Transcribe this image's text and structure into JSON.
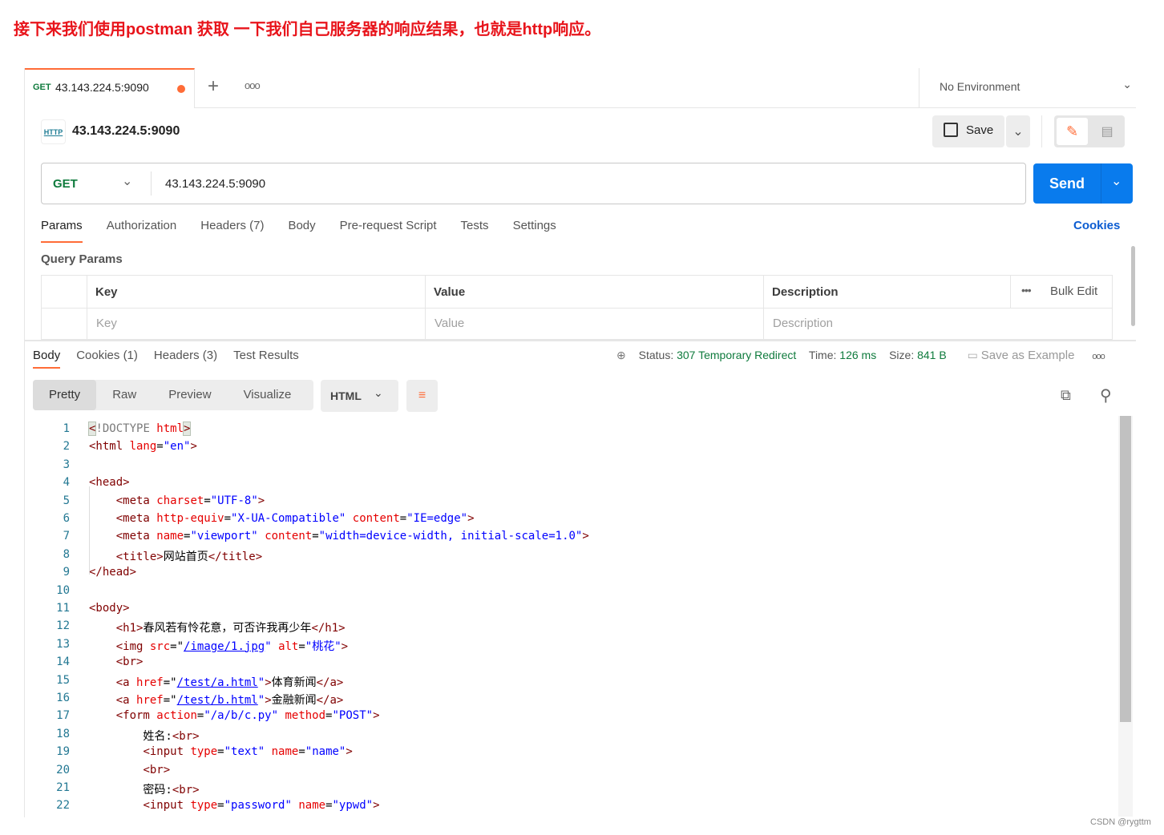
{
  "banner": "接下来我们使用postman 获取 一下我们自己服务器的响应结果，也就是http响应。",
  "tab": {
    "method": "GET",
    "title": "43.143.224.5:9090",
    "unsaved_color": "#ff6c37"
  },
  "environment": "No Environment",
  "request": {
    "name": "43.143.224.5:9090",
    "method": "GET",
    "url": "43.143.224.5:9090",
    "save": "Save",
    "send": "Send"
  },
  "req_tabs": [
    {
      "label": "Params",
      "active": true
    },
    {
      "label": "Authorization"
    },
    {
      "label": "Headers (7)"
    },
    {
      "label": "Body"
    },
    {
      "label": "Pre-request Script"
    },
    {
      "label": "Tests"
    },
    {
      "label": "Settings"
    }
  ],
  "cookies_link": "Cookies",
  "query_params": {
    "title": "Query Params",
    "headers": [
      "Key",
      "Value",
      "Description"
    ],
    "bulk_edit": "Bulk Edit",
    "placeholders": [
      "Key",
      "Value",
      "Description"
    ]
  },
  "resp_tabs": [
    {
      "label": "Body",
      "active": true
    },
    {
      "label": "Cookies (1)"
    },
    {
      "label": "Headers (3)"
    },
    {
      "label": "Test Results"
    }
  ],
  "status": {
    "status_label": "Status:",
    "status": "307 Temporary Redirect",
    "time_label": "Time:",
    "time": "126 ms",
    "size_label": "Size:",
    "size": "841 B",
    "save_example": "Save as Example"
  },
  "view_modes": [
    "Pretty",
    "Raw",
    "Preview",
    "Visualize"
  ],
  "format": "HTML",
  "colors": {
    "accent": "#ff6c37",
    "send": "#097bed",
    "ok": "#0f7b3d",
    "link": "#0b5cd1"
  },
  "code": [
    [
      [
        "b",
        "<"
      ],
      [
        "d",
        "!DOCTYPE "
      ],
      [
        "a",
        "html"
      ],
      [
        "b",
        ">"
      ]
    ],
    [
      [
        "t",
        "<html "
      ],
      [
        "a",
        "lang"
      ],
      [
        "x",
        "="
      ],
      [
        "v",
        "\"en\""
      ],
      [
        "t",
        ">"
      ]
    ],
    [],
    [
      [
        "t",
        "<head>"
      ]
    ],
    [
      [
        "x",
        "    "
      ],
      [
        "t",
        "<meta "
      ],
      [
        "a",
        "charset"
      ],
      [
        "x",
        "="
      ],
      [
        "v",
        "\"UTF-8\""
      ],
      [
        "t",
        ">"
      ]
    ],
    [
      [
        "x",
        "    "
      ],
      [
        "t",
        "<meta "
      ],
      [
        "a",
        "http-equiv"
      ],
      [
        "x",
        "="
      ],
      [
        "v",
        "\"X-UA-Compatible\""
      ],
      [
        "x",
        " "
      ],
      [
        "a",
        "content"
      ],
      [
        "x",
        "="
      ],
      [
        "v",
        "\"IE=edge\""
      ],
      [
        "t",
        ">"
      ]
    ],
    [
      [
        "x",
        "    "
      ],
      [
        "t",
        "<meta "
      ],
      [
        "a",
        "name"
      ],
      [
        "x",
        "="
      ],
      [
        "v",
        "\"viewport\""
      ],
      [
        "x",
        " "
      ],
      [
        "a",
        "content"
      ],
      [
        "x",
        "="
      ],
      [
        "v",
        "\"width=device-width, initial-scale=1.0\""
      ],
      [
        "t",
        ">"
      ]
    ],
    [
      [
        "x",
        "    "
      ],
      [
        "t",
        "<title>"
      ],
      [
        "x",
        "网站首页"
      ],
      [
        "t",
        "</title>"
      ]
    ],
    [
      [
        "t",
        "</head>"
      ]
    ],
    [],
    [
      [
        "t",
        "<body>"
      ]
    ],
    [
      [
        "x",
        "    "
      ],
      [
        "t",
        "<h1>"
      ],
      [
        "x",
        "春风若有怜花意，可否许我再少年"
      ],
      [
        "t",
        "</h1>"
      ]
    ],
    [
      [
        "x",
        "    "
      ],
      [
        "t",
        "<img "
      ],
      [
        "a",
        "src"
      ],
      [
        "x",
        "=\""
      ],
      [
        "l",
        "/image/1.jpg"
      ],
      [
        "v",
        "\""
      ],
      [
        "x",
        " "
      ],
      [
        "a",
        "alt"
      ],
      [
        "x",
        "="
      ],
      [
        "v",
        "\"桃花\""
      ],
      [
        "t",
        ">"
      ]
    ],
    [
      [
        "x",
        "    "
      ],
      [
        "t",
        "<br>"
      ]
    ],
    [
      [
        "x",
        "    "
      ],
      [
        "t",
        "<a "
      ],
      [
        "a",
        "href"
      ],
      [
        "x",
        "=\""
      ],
      [
        "l",
        "/test/a.html"
      ],
      [
        "v",
        "\""
      ],
      [
        "t",
        ">"
      ],
      [
        "x",
        "体育新闻"
      ],
      [
        "t",
        "</a>"
      ]
    ],
    [
      [
        "x",
        "    "
      ],
      [
        "t",
        "<a "
      ],
      [
        "a",
        "href"
      ],
      [
        "x",
        "=\""
      ],
      [
        "l",
        "/test/b.html"
      ],
      [
        "v",
        "\""
      ],
      [
        "t",
        ">"
      ],
      [
        "x",
        "金融新闻"
      ],
      [
        "t",
        "</a>"
      ]
    ],
    [
      [
        "x",
        "    "
      ],
      [
        "t",
        "<form "
      ],
      [
        "a",
        "action"
      ],
      [
        "x",
        "="
      ],
      [
        "v",
        "\"/a/b/c.py\""
      ],
      [
        "x",
        " "
      ],
      [
        "a",
        "method"
      ],
      [
        "x",
        "="
      ],
      [
        "v",
        "\"POST\""
      ],
      [
        "t",
        ">"
      ]
    ],
    [
      [
        "x",
        "        姓名:"
      ],
      [
        "t",
        "<br>"
      ]
    ],
    [
      [
        "x",
        "        "
      ],
      [
        "t",
        "<input "
      ],
      [
        "a",
        "type"
      ],
      [
        "x",
        "="
      ],
      [
        "v",
        "\"text\""
      ],
      [
        "x",
        " "
      ],
      [
        "a",
        "name"
      ],
      [
        "x",
        "="
      ],
      [
        "v",
        "\"name\""
      ],
      [
        "t",
        ">"
      ]
    ],
    [
      [
        "x",
        "        "
      ],
      [
        "t",
        "<br>"
      ]
    ],
    [
      [
        "x",
        "        密码:"
      ],
      [
        "t",
        "<br>"
      ]
    ],
    [
      [
        "x",
        "        "
      ],
      [
        "t",
        "<input "
      ],
      [
        "a",
        "type"
      ],
      [
        "x",
        "="
      ],
      [
        "v",
        "\"password\""
      ],
      [
        "x",
        " "
      ],
      [
        "a",
        "name"
      ],
      [
        "x",
        "="
      ],
      [
        "v",
        "\"ypwd\""
      ],
      [
        "t",
        ">"
      ]
    ]
  ],
  "watermark": "CSDN @rygttm"
}
